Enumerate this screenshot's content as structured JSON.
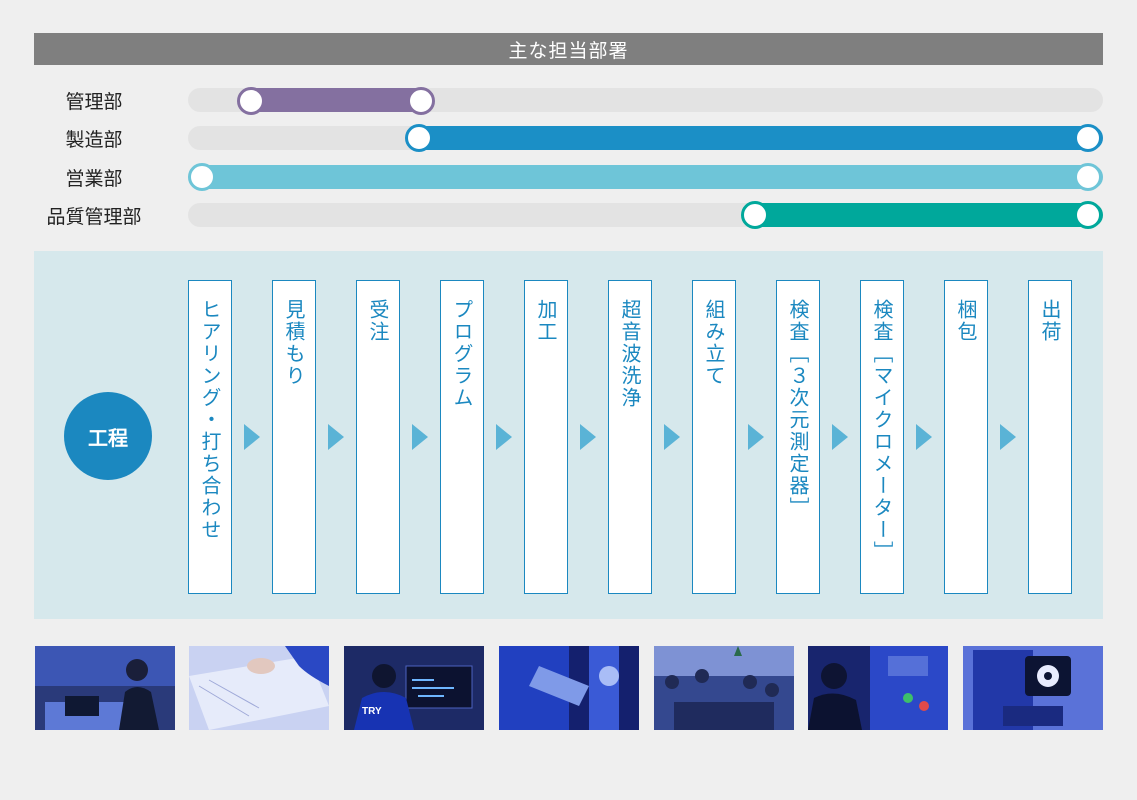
{
  "header": {
    "title": "主な担当部署"
  },
  "departments": [
    {
      "name": "管理部",
      "color": "#8470a0"
    },
    {
      "name": "製造部",
      "color": "#1b8fc6"
    },
    {
      "name": "営業部",
      "color": "#6ec5d8"
    },
    {
      "name": "品質管理部",
      "color": "#00a89b"
    }
  ],
  "process": {
    "label": "工程",
    "steps": [
      {
        "label": "ヒアリング・打ち合わせ"
      },
      {
        "label": "見積もり"
      },
      {
        "label": "受注"
      },
      {
        "label": "プログラム"
      },
      {
        "label": "加工"
      },
      {
        "label": "超音波洗浄"
      },
      {
        "label": "組み立て"
      },
      {
        "label": "検査［３次元測定器］"
      },
      {
        "label": "検査［マイクロメーター］"
      },
      {
        "label": "梱包"
      },
      {
        "label": "出荷"
      }
    ]
  },
  "photos": [
    {
      "subject": "office-phone-call-photo"
    },
    {
      "subject": "document-handover-photo"
    },
    {
      "subject": "programming-workstation-photo"
    },
    {
      "subject": "machining-photo"
    },
    {
      "subject": "meeting-photo"
    },
    {
      "subject": "machine-operator-photo"
    },
    {
      "subject": "measuring-instrument-photo"
    }
  ]
}
